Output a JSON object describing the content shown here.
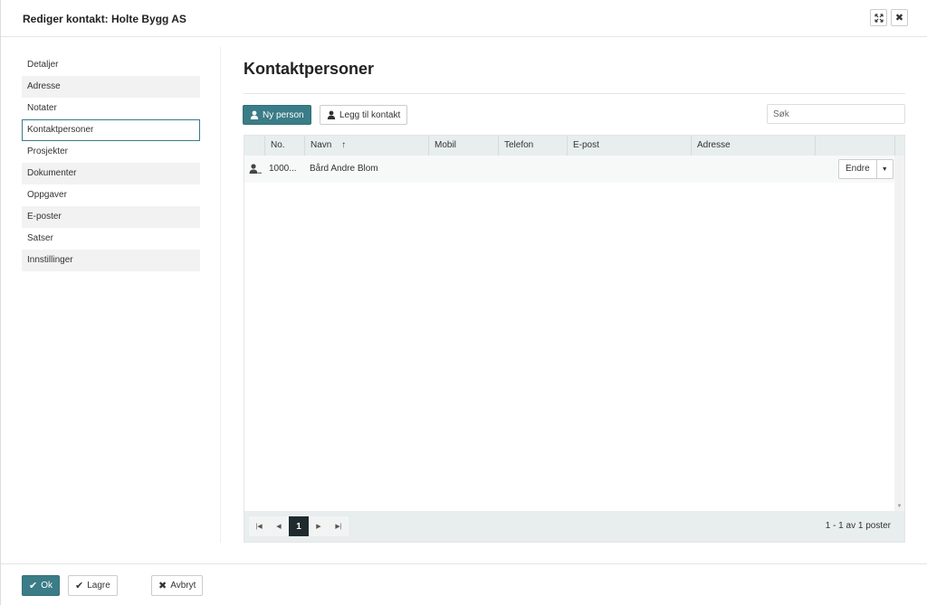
{
  "header": {
    "title": "Rediger kontakt: Holte Bygg AS",
    "expand_icon": "expand-icon",
    "close_icon": "close-icon"
  },
  "sidebar": {
    "items": [
      {
        "label": "Detaljer"
      },
      {
        "label": "Adresse"
      },
      {
        "label": "Notater"
      },
      {
        "label": "Kontaktpersoner"
      },
      {
        "label": "Prosjekter"
      },
      {
        "label": "Dokumenter"
      },
      {
        "label": "Oppgaver"
      },
      {
        "label": "E-poster"
      },
      {
        "label": "Satser"
      },
      {
        "label": "Innstillinger"
      }
    ],
    "active_item": "Kontaktpersoner"
  },
  "main": {
    "title": "Kontaktpersoner",
    "new_person_label": "Ny person",
    "add_contact_label": "Legg til kontakt",
    "search_placeholder": "Søk"
  },
  "grid": {
    "columns": [
      "",
      "No.",
      "Navn",
      "Mobil",
      "Telefon",
      "E-post",
      "Adresse",
      ""
    ],
    "sort_indicator": "↑",
    "rows": [
      {
        "no": "1000...",
        "navn": "Bård Andre Blom",
        "mobil": "",
        "telefon": "",
        "epost": "",
        "adresse": "",
        "action": "Endre"
      }
    ]
  },
  "pager": {
    "current_page": "1",
    "info": "1 - 1 av 1 poster"
  },
  "footer": {
    "ok_label": "Ok",
    "save_label": "Lagre",
    "cancel_label": "Avbryt"
  },
  "colors": {
    "primary": "#3a7c87",
    "grid_header": "#e8eded"
  }
}
